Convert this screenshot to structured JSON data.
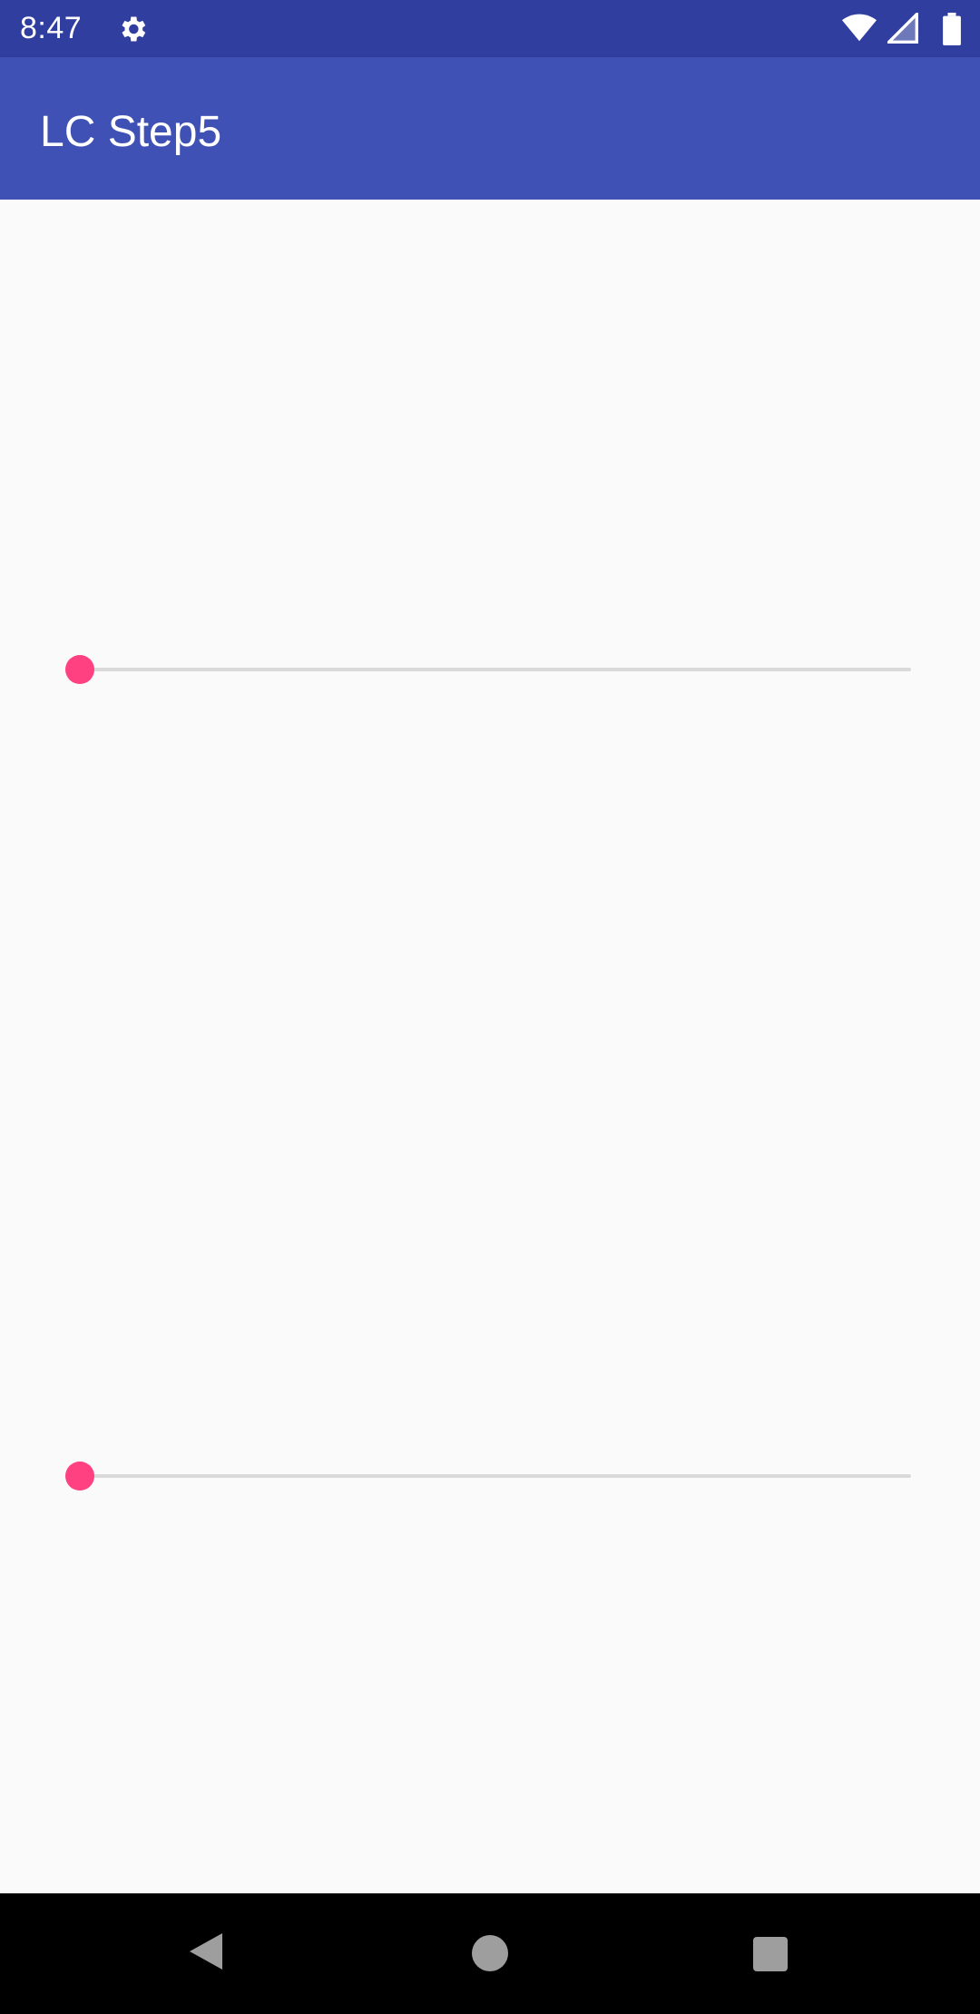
{
  "status_bar": {
    "time": "8:47",
    "icons": [
      "settings-gear-icon",
      "wifi-icon",
      "cellular-signal-icon",
      "battery-icon"
    ]
  },
  "app_bar": {
    "title": "LC Step5"
  },
  "sliders": [
    {
      "name": "seekbar-top",
      "value": 0
    },
    {
      "name": "seekbar-bottom",
      "value": 0
    }
  ],
  "nav_bar": {
    "icons": [
      "back-icon",
      "home-icon",
      "recents-icon"
    ]
  },
  "colors": {
    "status_bar": "#303f9f",
    "app_bar": "#3f51b5",
    "accent": "#ff4081",
    "background": "#fafafa"
  }
}
